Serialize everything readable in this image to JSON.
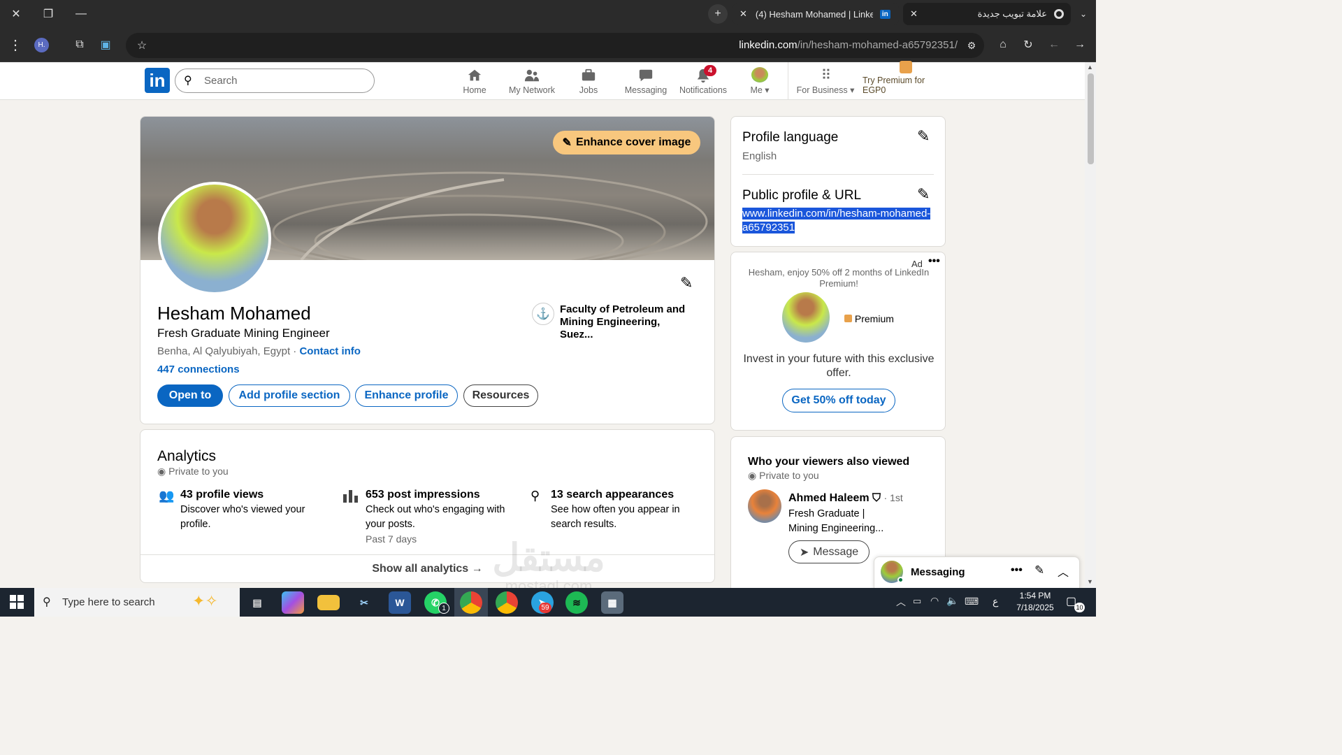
{
  "browser": {
    "tab_active_title": "(4) Hesham Mohamed | LinkedIn",
    "tab_new_title": "علامة تبويب جديدة",
    "url_domain": "linkedin.com",
    "url_path": "/in/hesham-mohamed-a65792351/",
    "profile_badge": "H."
  },
  "nav": {
    "search_placeholder": "Search",
    "items": [
      {
        "label": "Home",
        "icon": "home-icon"
      },
      {
        "label": "My Network",
        "icon": "people-icon"
      },
      {
        "label": "Jobs",
        "icon": "briefcase-icon"
      },
      {
        "label": "Messaging",
        "icon": "chat-icon"
      },
      {
        "label": "Notifications",
        "icon": "bell-icon"
      },
      {
        "label": "Me",
        "icon": "avatar"
      }
    ],
    "notifications_badge": "4",
    "for_business": "For Business",
    "premium_label": "Try Premium for EGP0"
  },
  "profile": {
    "enhance_cover": "Enhance cover image",
    "name": "Hesham Mohamed",
    "headline": "Fresh Graduate Mining Engineer",
    "location": "Benha, Al Qalyubiyah, Egypt",
    "separator": "·",
    "contact_info": "Contact info",
    "connections": "447 connections",
    "education": "Faculty of Petroleum and Mining Engineering, Suez...",
    "buttons": {
      "open_to": "Open to",
      "add_section": "Add profile section",
      "enhance": "Enhance profile",
      "resources": "Resources"
    }
  },
  "analytics": {
    "title": "Analytics",
    "privacy": "Private to you",
    "items": [
      {
        "title": "43 profile views",
        "desc": "Discover who's viewed your profile.",
        "note": ""
      },
      {
        "title": "653 post impressions",
        "desc": "Check out who's engaging with your posts.",
        "note": "Past 7 days"
      },
      {
        "title": "13 search appearances",
        "desc": "See how often you appear in search results.",
        "note": ""
      }
    ],
    "show_all": "Show all analytics →"
  },
  "sidebar": {
    "language_title": "Profile language",
    "language_value": "English",
    "public_title": "Public profile & URL",
    "public_url": "www.linkedin.com/in/hesham-mohamed-a65792351"
  },
  "ad": {
    "label": "Ad",
    "text": "Hesham, enjoy 50% off 2 months of LinkedIn Premium!",
    "premium": "Premium",
    "pitch": "Invest in your future with this exclusive offer.",
    "cta": "Get 50% off today"
  },
  "viewers": {
    "title": "Who your viewers also viewed",
    "privacy": "Private to you",
    "person_name": "Ahmed Haleem",
    "degree": "· 1st",
    "person_headline": "Fresh Graduate | Mining Engineering...",
    "message_btn": "Message"
  },
  "messaging": {
    "label": "Messaging"
  },
  "taskbar": {
    "search_placeholder": "Type here to search",
    "time": "1:54 PM",
    "date": "7/18/2025",
    "lang": "ع",
    "notif_count": "10",
    "whatsapp_badge": "1",
    "telegram_badge": "59"
  },
  "watermark": {
    "text": "مستقل",
    "sub": "mostaql.com"
  },
  "colors": {
    "linkedin_blue": "#0a66c2",
    "premium_gold": "#f8c77e",
    "notif_red": "#cb112d"
  }
}
